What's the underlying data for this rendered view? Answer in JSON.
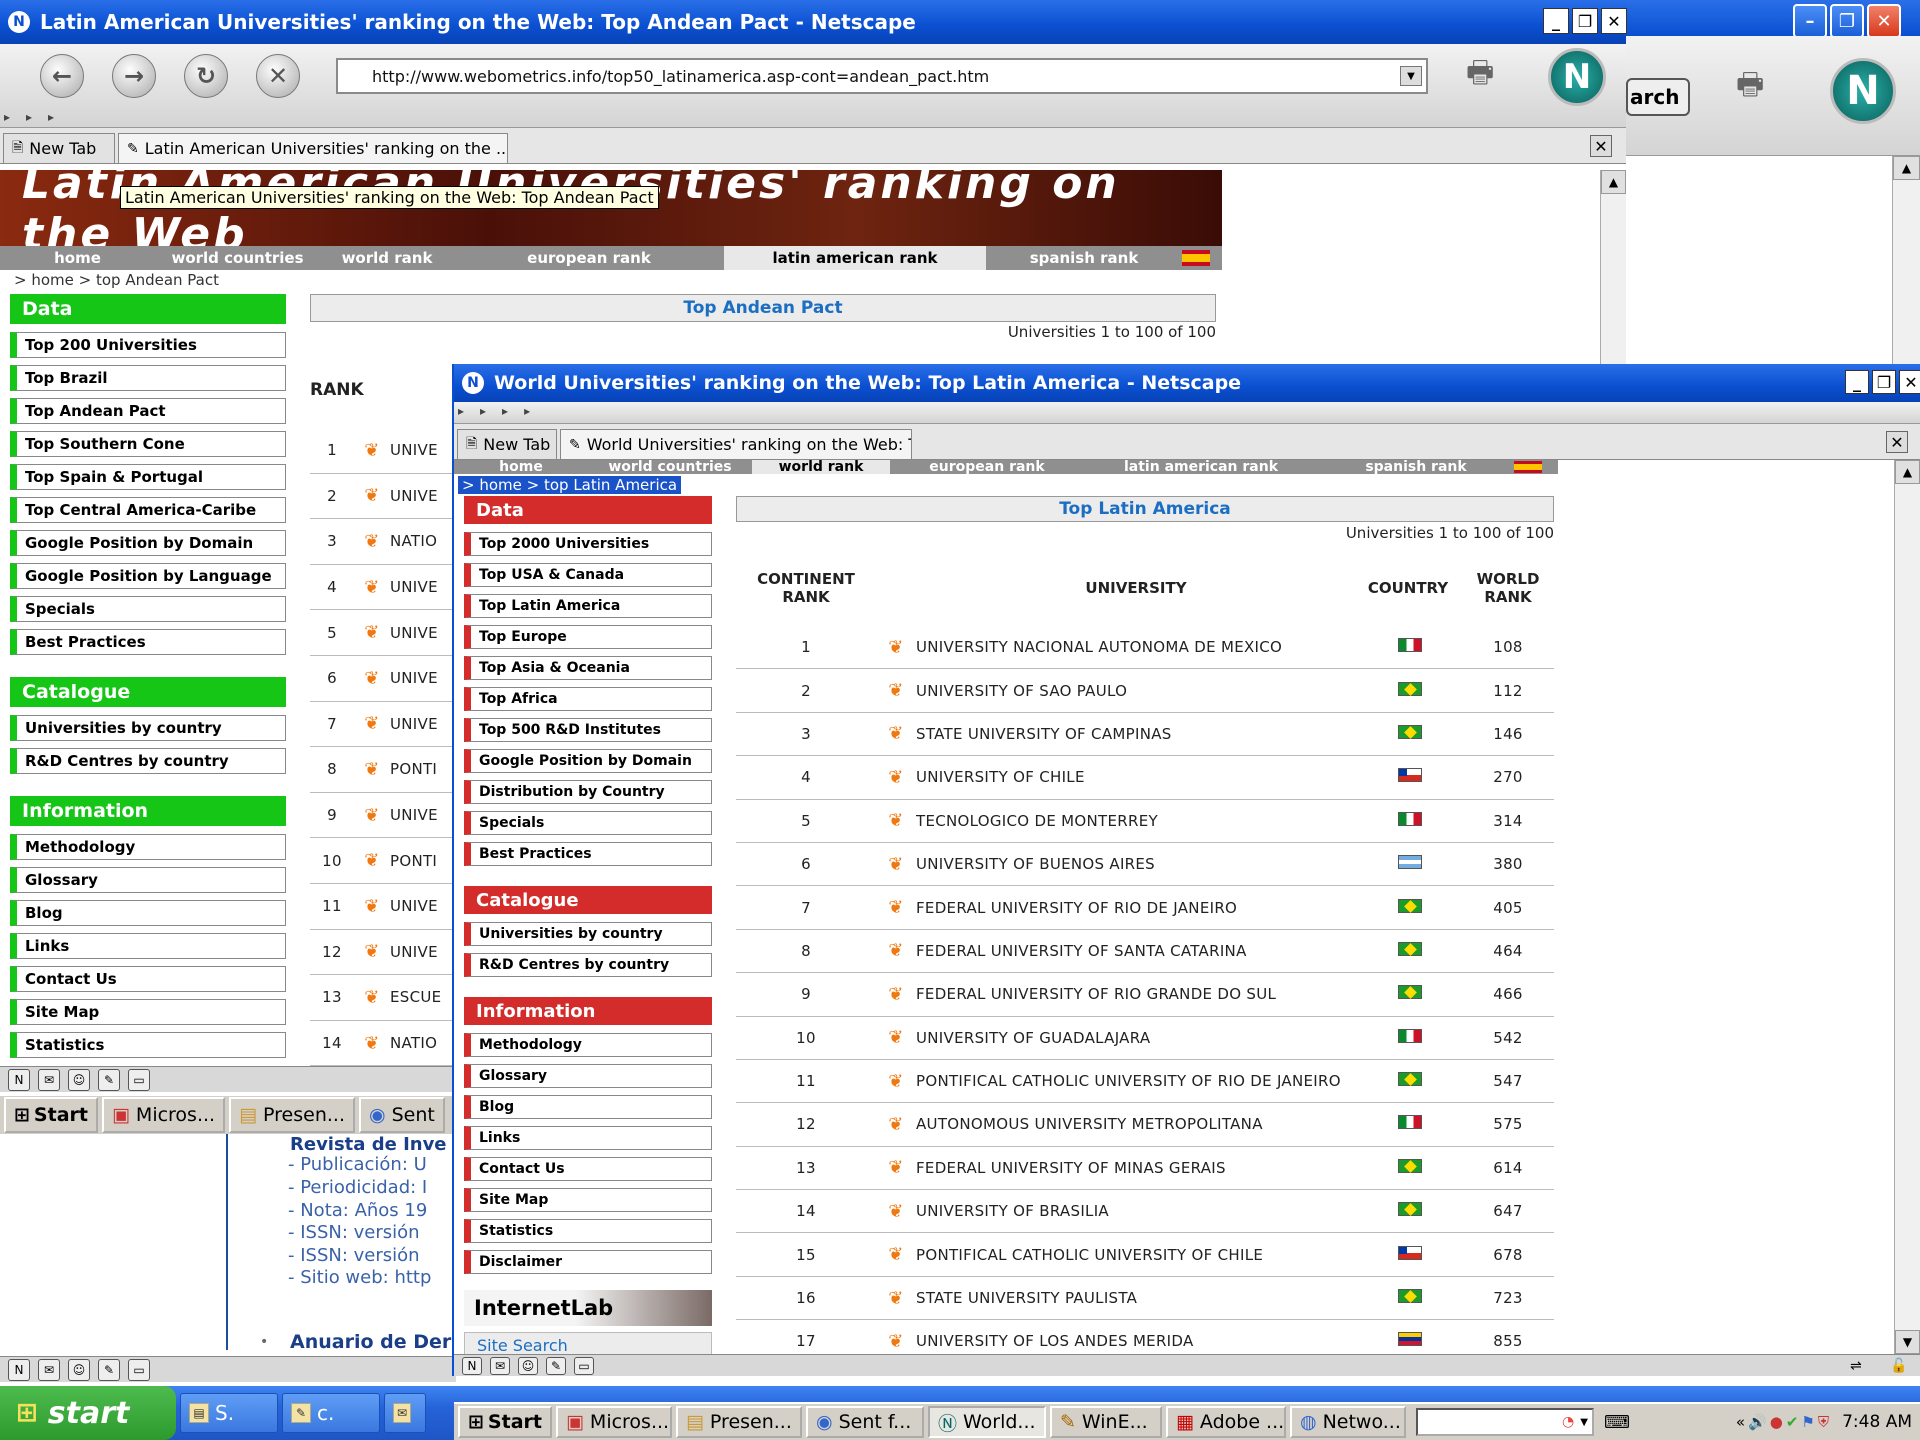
{
  "back_window": {
    "title": "Latin American Universities' ranking on the Web: Top Andean Pact - Netscape",
    "search_label": "arch",
    "url": "http://www.webometrics.info/top50_latinamerica.asp-cont=andean_pact.htm",
    "tabs": [
      {
        "label": "New Tab"
      },
      {
        "label": "Latin American Universities' ranking on the ..."
      }
    ],
    "banner_text": "Latin American Universities' ranking on the Web",
    "tooltip": "Latin American Universities' ranking on the Web: Top Andean Pact",
    "nav": [
      "home",
      "world countries",
      "world rank",
      "european rank",
      "latin american rank",
      "spanish rank"
    ],
    "breadcrumb": ">  home >  top Andean Pact",
    "data_head": "Data",
    "data_items": [
      "Top 200 Universities",
      "Top Brazil",
      "Top Andean Pact",
      "Top Southern Cone",
      "Top Spain & Portugal",
      "Top Central America-Caribe",
      "Google Position by Domain",
      "Google Position by Language",
      "Specials",
      "Best Practices"
    ],
    "catalogue_head": "Catalogue",
    "catalogue_items": [
      "Universities by country",
      "R&D Centres by country"
    ],
    "info_head": "Information",
    "info_items": [
      "Methodology",
      "Glossary",
      "Blog",
      "Links",
      "Contact Us",
      "Site Map",
      "Statistics"
    ],
    "table_title": "Top Andean Pact",
    "range_text": "Universities 1 to 100 of 100",
    "rank_header": "RANK",
    "rows": [
      {
        "rank": "1",
        "name": "UNIVE"
      },
      {
        "rank": "2",
        "name": "UNIVE"
      },
      {
        "rank": "3",
        "name": "NATIO"
      },
      {
        "rank": "4",
        "name": "UNIVE"
      },
      {
        "rank": "5",
        "name": "UNIVE"
      },
      {
        "rank": "6",
        "name": "UNIVE"
      },
      {
        "rank": "7",
        "name": "UNIVE"
      },
      {
        "rank": "8",
        "name": "PONTI"
      },
      {
        "rank": "9",
        "name": "UNIVE"
      },
      {
        "rank": "10",
        "name": "PONTI"
      },
      {
        "rank": "11",
        "name": "UNIVE"
      },
      {
        "rank": "12",
        "name": "UNIVE"
      },
      {
        "rank": "13",
        "name": "ESCUE"
      },
      {
        "rank": "14",
        "name": "NATIO"
      }
    ]
  },
  "mid_taskbar": {
    "start": "Start",
    "tasks": [
      "Micros...",
      "Presen...",
      "Sent"
    ]
  },
  "doc_window": {
    "lines": [
      "Revista de Inve",
      "- Publicación: U",
      "- Periodicidad: I",
      "- Nota: Años 19",
      "- ISSN: versión",
      "- ISSN: versión",
      "- Sitio web: http"
    ],
    "link_line": "Anuario de Dere"
  },
  "front_window": {
    "title": "World Universities' ranking on the Web: Top Latin America - Netscape",
    "tabs": [
      {
        "label": "New Tab"
      },
      {
        "label": "World Universities' ranking on the Web: To..."
      }
    ],
    "nav": [
      "home",
      "world countries",
      "world rank",
      "european rank",
      "latin american rank",
      "spanish rank"
    ],
    "breadcrumb": ">  home > top Latin America",
    "data_head": "Data",
    "data_items": [
      "Top 2000 Universities",
      "Top USA & Canada",
      "Top Latin America",
      "Top Europe",
      "Top Asia & Oceania",
      "Top Africa",
      "Top 500 R&D Institutes",
      "Google Position by Domain",
      "Distribution by Country",
      "Specials",
      "Best Practices"
    ],
    "catalogue_head": "Catalogue",
    "catalogue_items": [
      "Universities by country",
      "R&D Centres by country"
    ],
    "info_head": "Information",
    "info_items": [
      "Methodology",
      "Glossary",
      "Blog",
      "Links",
      "Contact Us",
      "Site Map",
      "Statistics",
      "Disclaimer"
    ],
    "internetlab": "InternetLab",
    "site_search": "Site Search",
    "table_title": "Top Latin America",
    "range_text": "Universities 1 to 100 of 100",
    "headers": {
      "continent_rank_1": "CONTINENT",
      "continent_rank_2": "RANK",
      "university": "UNIVERSITY",
      "country": "COUNTRY",
      "world_rank_1": "WORLD",
      "world_rank_2": "RANK"
    },
    "rows": [
      {
        "rank": "1",
        "name": "UNIVERSITY NACIONAL AUTONOMA DE MEXICO",
        "flag": "mx",
        "world": "108"
      },
      {
        "rank": "2",
        "name": "UNIVERSITY OF SAO PAULO",
        "flag": "br",
        "world": "112"
      },
      {
        "rank": "3",
        "name": "STATE UNIVERSITY OF CAMPINAS",
        "flag": "br",
        "world": "146"
      },
      {
        "rank": "4",
        "name": "UNIVERSITY OF CHILE",
        "flag": "cl",
        "world": "270"
      },
      {
        "rank": "5",
        "name": "TECNOLOGICO DE MONTERREY",
        "flag": "mx",
        "world": "314"
      },
      {
        "rank": "6",
        "name": "UNIVERSITY OF BUENOS AIRES",
        "flag": "ar",
        "world": "380"
      },
      {
        "rank": "7",
        "name": "FEDERAL UNIVERSITY OF RIO DE JANEIRO",
        "flag": "br",
        "world": "405"
      },
      {
        "rank": "8",
        "name": "FEDERAL UNIVERSITY OF SANTA CATARINA",
        "flag": "br",
        "world": "464"
      },
      {
        "rank": "9",
        "name": "FEDERAL UNIVERSITY OF RIO GRANDE DO SUL",
        "flag": "br",
        "world": "466"
      },
      {
        "rank": "10",
        "name": "UNIVERSITY OF GUADALAJARA",
        "flag": "mx",
        "world": "542"
      },
      {
        "rank": "11",
        "name": "PONTIFICAL CATHOLIC UNIVERSITY OF RIO DE JANEIRO",
        "flag": "br",
        "world": "547"
      },
      {
        "rank": "12",
        "name": "AUTONOMOUS UNIVERSITY METROPOLITANA",
        "flag": "mx",
        "world": "575"
      },
      {
        "rank": "13",
        "name": "FEDERAL UNIVERSITY OF MINAS GERAIS",
        "flag": "br",
        "world": "614"
      },
      {
        "rank": "14",
        "name": "UNIVERSITY OF BRASILIA",
        "flag": "br",
        "world": "647"
      },
      {
        "rank": "15",
        "name": "PONTIFICAL CATHOLIC UNIVERSITY OF CHILE",
        "flag": "cl",
        "world": "678"
      },
      {
        "rank": "16",
        "name": "STATE UNIVERSITY PAULISTA",
        "flag": "br",
        "world": "723"
      },
      {
        "rank": "17",
        "name": "UNIVERSITY OF LOS ANDES MERIDA",
        "flag": "ve",
        "world": "855"
      }
    ]
  },
  "taskbar": {
    "start": "start",
    "outer_tasks": [
      "S.",
      "c."
    ],
    "inner_start": "Start",
    "inner_tasks": [
      "Micros...",
      "Presen...",
      "Sent f...",
      "World...",
      "WinE...",
      "Adobe ...",
      "Netwo..."
    ],
    "clock": "7:48 AM"
  },
  "colors": {
    "green": "#16c616",
    "red": "#d42b2b",
    "xp_blue": "#0a4fd0",
    "link_blue": "#1b6ec2"
  }
}
